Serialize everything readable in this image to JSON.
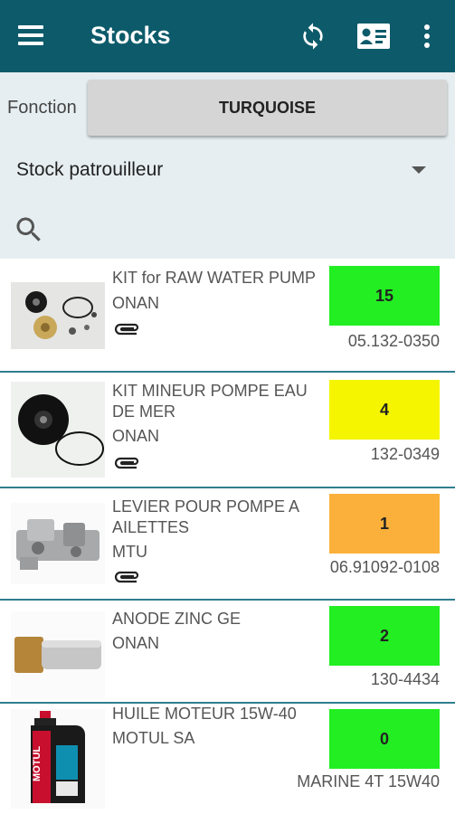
{
  "appbar": {
    "title": "Stocks",
    "icons": [
      "menu-icon",
      "sync-icon",
      "contact-card-icon",
      "more-vert-icon"
    ]
  },
  "filters": {
    "fonction_label": "Fonction",
    "fonction_value": "TURQUOISE",
    "stock_value": "Stock patrouilleur",
    "search_icon": "search-icon"
  },
  "colors": {
    "appbar": "#0d5b6a",
    "filter_bg": "#e6eef1",
    "divider": "#2f7f8f",
    "qty_green": "#22ee22",
    "qty_yellow": "#f5f500",
    "qty_orange": "#fbb03b"
  },
  "items": [
    {
      "name": "KIT for RAW WATER PUMP",
      "brand": "ONAN",
      "qty": "15",
      "qty_color": "#22ee22",
      "ref": "05.132-0350",
      "attachment": true,
      "image": "water-pump-kit"
    },
    {
      "name": "KIT MINEUR POMPE EAU DE MER",
      "brand": "ONAN",
      "qty": "4",
      "qty_color": "#f5f500",
      "ref": "132-0349",
      "attachment": true,
      "image": "impeller"
    },
    {
      "name": "LEVIER POUR POMPE A AILETTES",
      "brand": "MTU",
      "qty": "1",
      "qty_color": "#fbb03b",
      "ref": "06.91092-0108",
      "attachment": true,
      "image": "pump-lever"
    },
    {
      "name": "ANODE ZINC GE",
      "brand": "ONAN",
      "qty": "2",
      "qty_color": "#22ee22",
      "ref": "130-4434",
      "attachment": false,
      "image": "zinc-anode"
    },
    {
      "name": "HUILE MOTEUR 15W-40",
      "brand": "MOTUL SA",
      "qty": "0",
      "qty_color": "#22ee22",
      "ref": "MARINE 4T 15W40",
      "attachment": false,
      "image": "motul-oil-bottle",
      "image_text": "MOTUL"
    }
  ]
}
